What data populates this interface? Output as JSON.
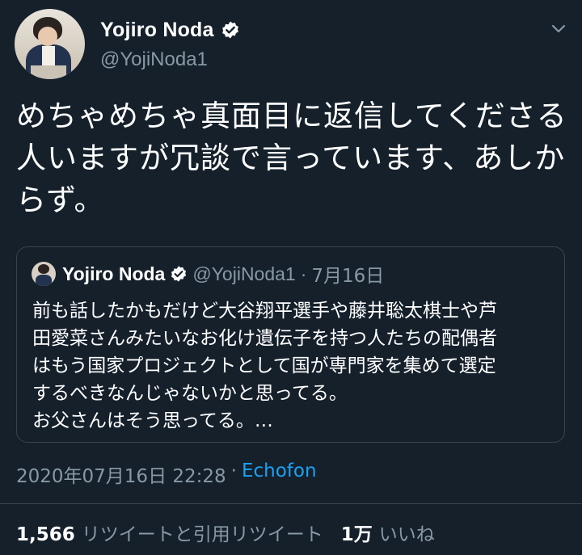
{
  "author": {
    "name": "Yojiro Noda",
    "handle": "@YojiNoda1",
    "verified": true,
    "avatar_icon": "profile-photo"
  },
  "tweet": {
    "lines": [
      "めちゃめちゃ真面目に返信してくださる",
      "人いますが冗談で言っています、あしか",
      "らず。"
    ],
    "timestamp": "2020年07月16日 22:28",
    "separator": "·",
    "source": "Echofon"
  },
  "quoted_tweet": {
    "name": "Yojiro Noda",
    "handle": "@YojiNoda1",
    "separator": "·",
    "date": "7月16日",
    "lines": [
      "前も話したかもだけど大谷翔平選手や藤井聡太棋士や芦",
      "田愛菜さんみたいなお化け遺伝子を持つ人たちの配偶者",
      "はもう国家プロジェクトとして国が専門家を集めて選定",
      "するべきなんじゃないかと思ってる。",
      "お父さんはそう思ってる。…"
    ]
  },
  "stats": {
    "retweets_count": "1,566",
    "retweets_label": "リツイートと引用リツイート",
    "likes_count": "1万",
    "likes_label": "いいね"
  },
  "colors": {
    "background": "#15202b",
    "secondary_text": "#8899a6",
    "accent": "#1da1f2",
    "border": "#38444d"
  },
  "icons": [
    "verified-badge-icon",
    "chevron-down-icon"
  ]
}
